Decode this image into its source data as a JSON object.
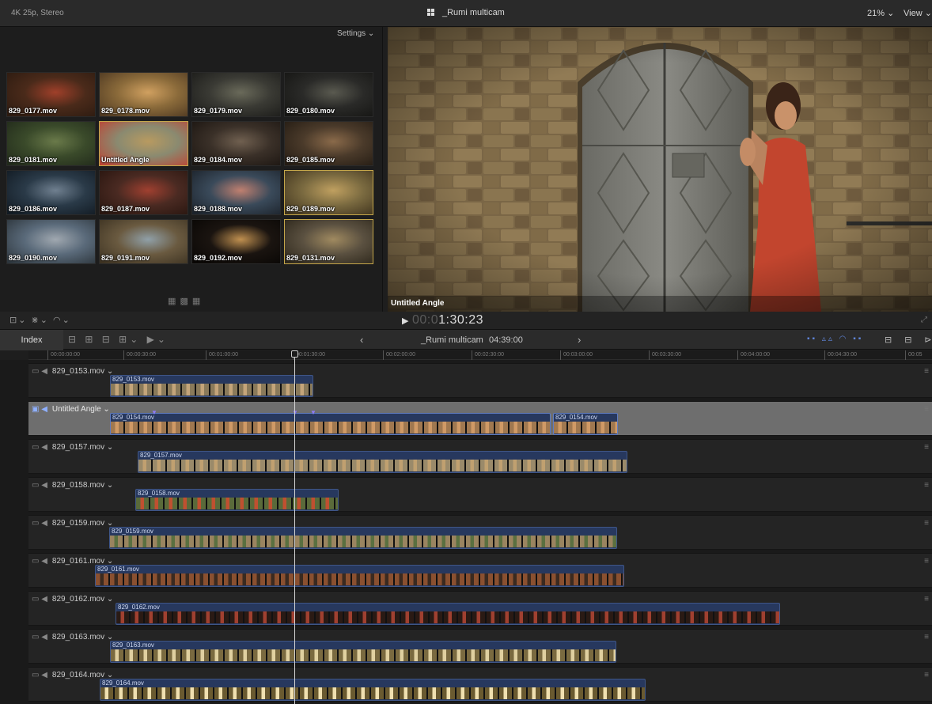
{
  "topbar": {
    "format": "4K 25p, Stereo",
    "title": "_Rumi multicam",
    "zoom": "21% ⌄",
    "view": "View ⌄"
  },
  "angle_viewer": {
    "settings_label": "Settings ⌄",
    "tiles": [
      "829_0177.mov",
      "829_0178.mov",
      "829_0179.mov",
      "829_0180.mov",
      "829_0181.mov",
      "Untitled Angle",
      "829_0184.mov",
      "829_0185.mov",
      "829_0186.mov",
      "829_0187.mov",
      "829_0188.mov",
      "829_0189.mov",
      "829_0190.mov",
      "829_0191.mov",
      "829_0192.mov",
      "829_0131.mov"
    ]
  },
  "viewer": {
    "angle_label": "Untitled Angle"
  },
  "transport": {
    "tc_dim": "00:0",
    "tc": "1:30:23"
  },
  "timeline_header": {
    "index": "Index",
    "name": "_Rumi multicam",
    "duration": "04:39:00"
  },
  "ruler": [
    "00:00:00:00",
    "00:00:30:00",
    "00:01:00:00",
    "00:01:30:00",
    "00:02:00:00",
    "00:02:30:00",
    "00:03:00:00",
    "00:03:30:00",
    "00:04:00:00",
    "00:04:30:00",
    "00:05"
  ],
  "lanes": [
    {
      "label": "829_0153.mov ⌄",
      "clips": [
        {
          "name": "829_0153.mov"
        }
      ]
    },
    {
      "label": "Untitled Angle ⌄",
      "clips": [
        {
          "name": "829_0154.mov"
        },
        {
          "name": "829_0154.mov"
        }
      ]
    },
    {
      "label": "829_0157.mov ⌄",
      "clips": [
        {
          "name": "829_0157.mov"
        }
      ]
    },
    {
      "label": "829_0158.mov ⌄",
      "clips": [
        {
          "name": "829_0158.mov"
        }
      ]
    },
    {
      "label": "829_0159.mov ⌄",
      "clips": [
        {
          "name": "829_0159.mov"
        }
      ]
    },
    {
      "label": "829_0161.mov ⌄",
      "clips": [
        {
          "name": "829_0161.mov"
        }
      ]
    },
    {
      "label": "829_0162.mov ⌄",
      "clips": [
        {
          "name": "829_0162.mov"
        }
      ]
    },
    {
      "label": "829_0163.mov ⌄",
      "clips": [
        {
          "name": "829_0163.mov"
        }
      ]
    },
    {
      "label": "829_0164.mov ⌄",
      "clips": [
        {
          "name": "829_0164.mov"
        }
      ]
    }
  ]
}
